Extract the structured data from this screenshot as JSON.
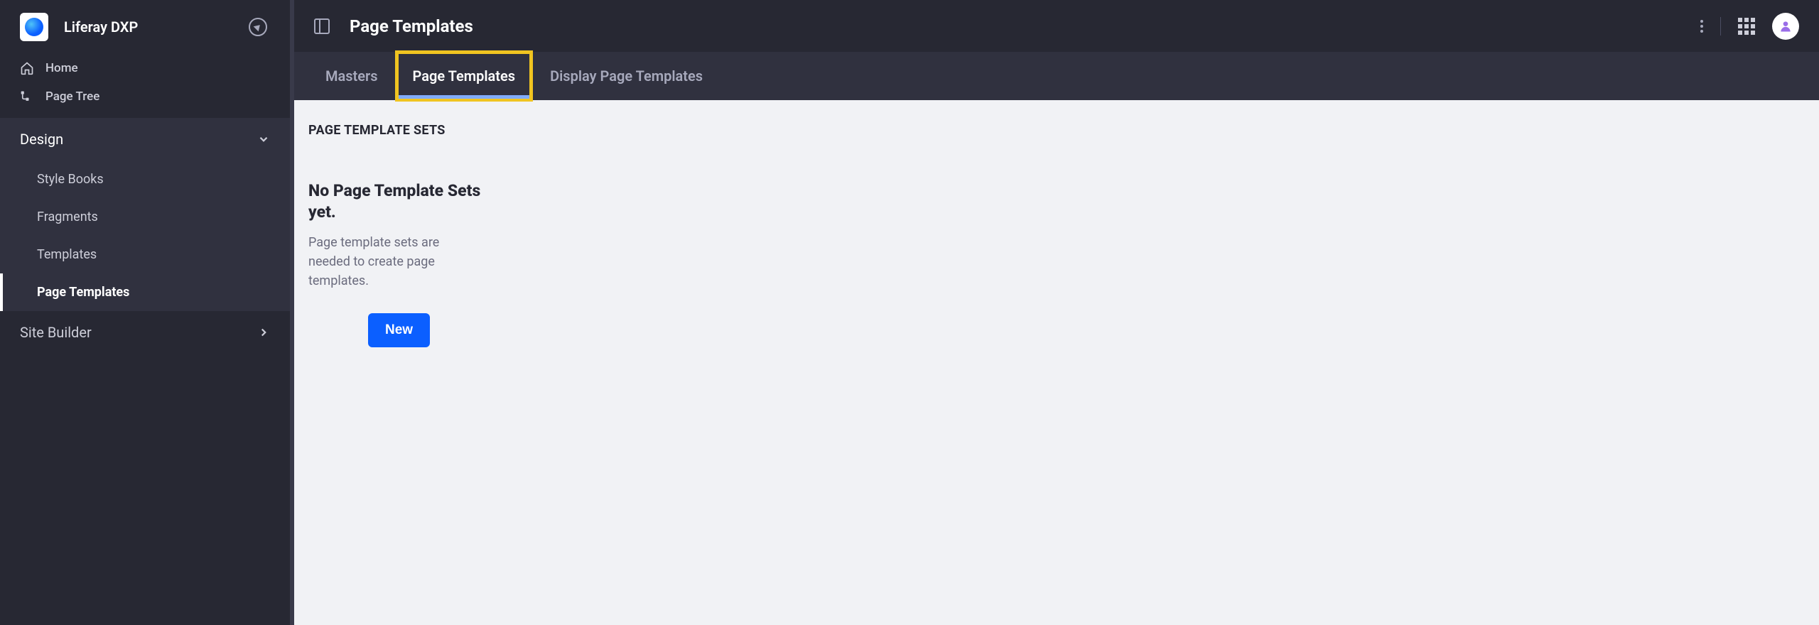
{
  "header": {
    "app_title": "Liferay DXP"
  },
  "nav": {
    "home": "Home",
    "page_tree": "Page Tree"
  },
  "sections": {
    "design": {
      "title": "Design",
      "items": [
        {
          "label": "Style Books"
        },
        {
          "label": "Fragments"
        },
        {
          "label": "Templates"
        },
        {
          "label": "Page Templates"
        }
      ]
    },
    "site_builder": {
      "title": "Site Builder"
    }
  },
  "main": {
    "page_title": "Page Templates",
    "tabs": [
      {
        "label": "Masters"
      },
      {
        "label": "Page Templates"
      },
      {
        "label": "Display Page Templates"
      }
    ],
    "content": {
      "heading": "PAGE TEMPLATE SETS",
      "empty_title": "No Page Template Sets yet.",
      "empty_desc": "Page template sets are needed to create page templates.",
      "new_button": "New"
    }
  }
}
